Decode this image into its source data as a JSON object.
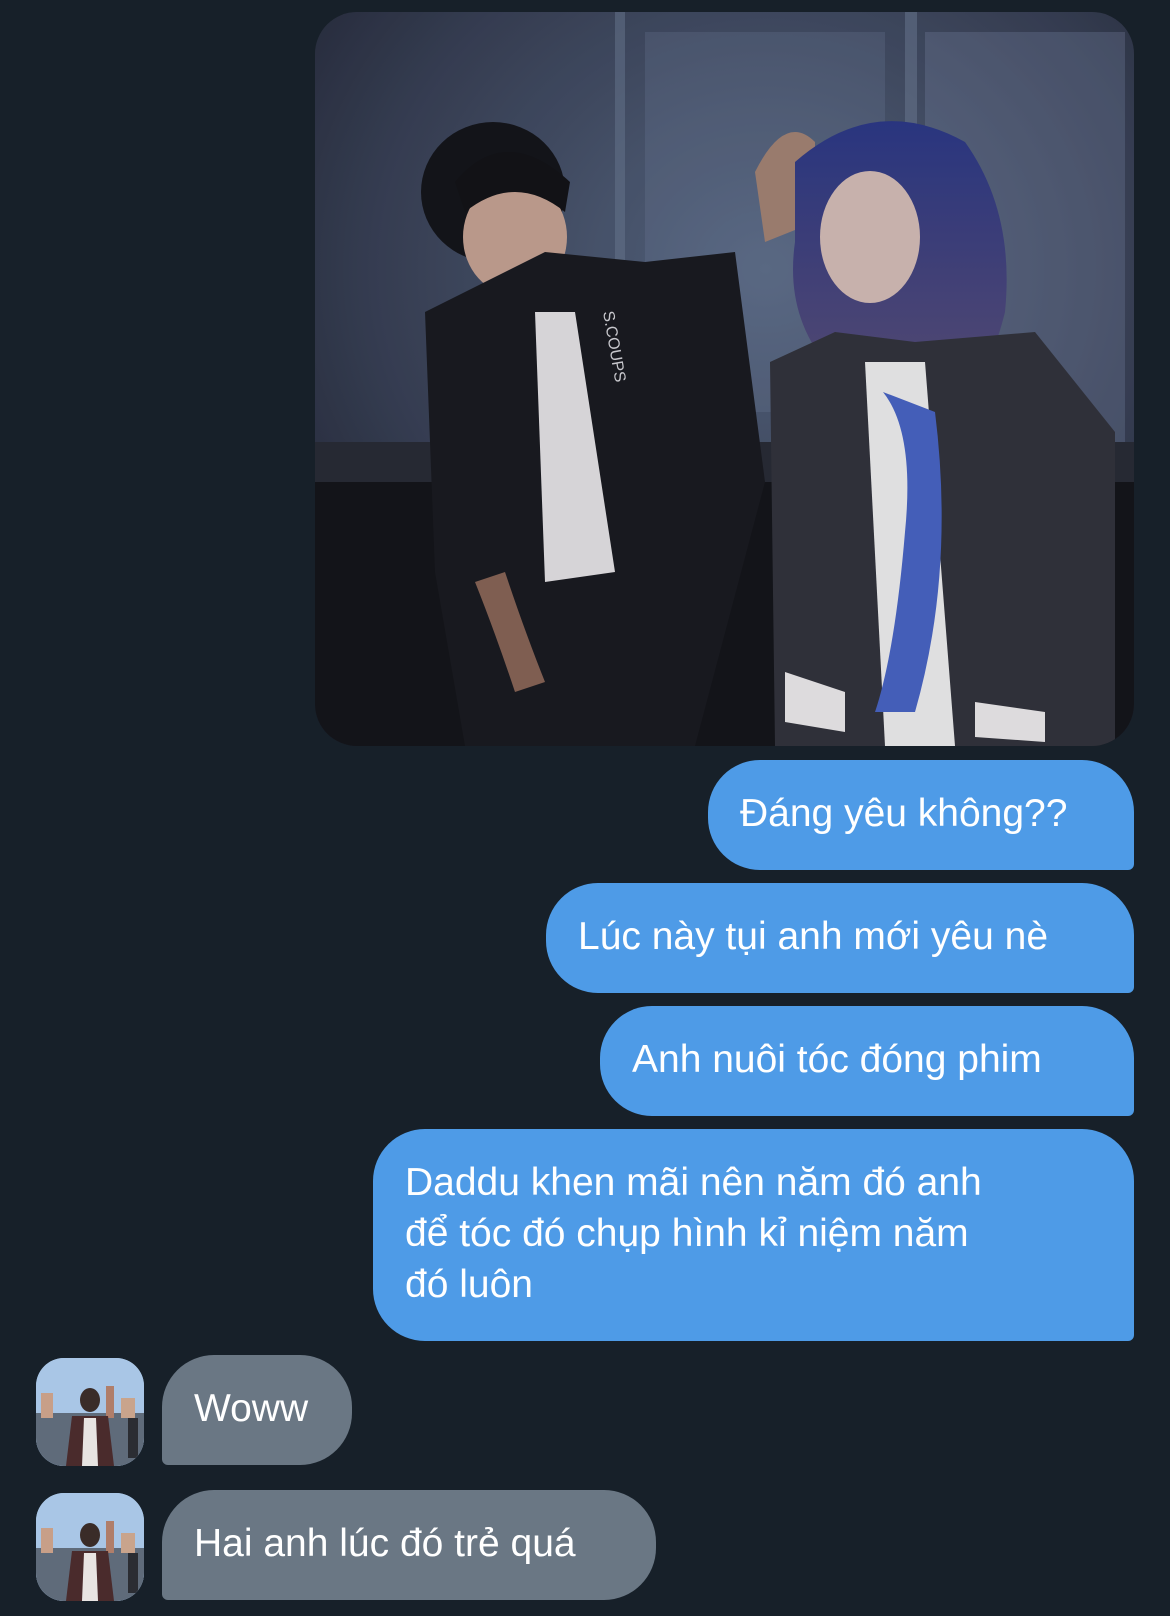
{
  "conversation": {
    "outgoing": [
      {
        "text": "Đáng yêu không??"
      },
      {
        "text": "Lúc này tụi anh mới yêu nè"
      },
      {
        "text": "Anh nuôi tóc đóng phim"
      },
      {
        "text": "Daddu khen mãi nên năm đó anh\nđể tóc đó chụp hình kỉ niệm năm\nđó luôn"
      }
    ],
    "incoming": [
      {
        "text": "Woww"
      },
      {
        "text": "Hai anh lúc đó trẻ quá"
      }
    ]
  },
  "photo": {
    "jacket_text": "S.COUPS"
  },
  "colors": {
    "background": "#172029",
    "outgoing_bubble": "#4e9be7",
    "incoming_bubble": "#6a7784",
    "text": "#ffffff"
  }
}
